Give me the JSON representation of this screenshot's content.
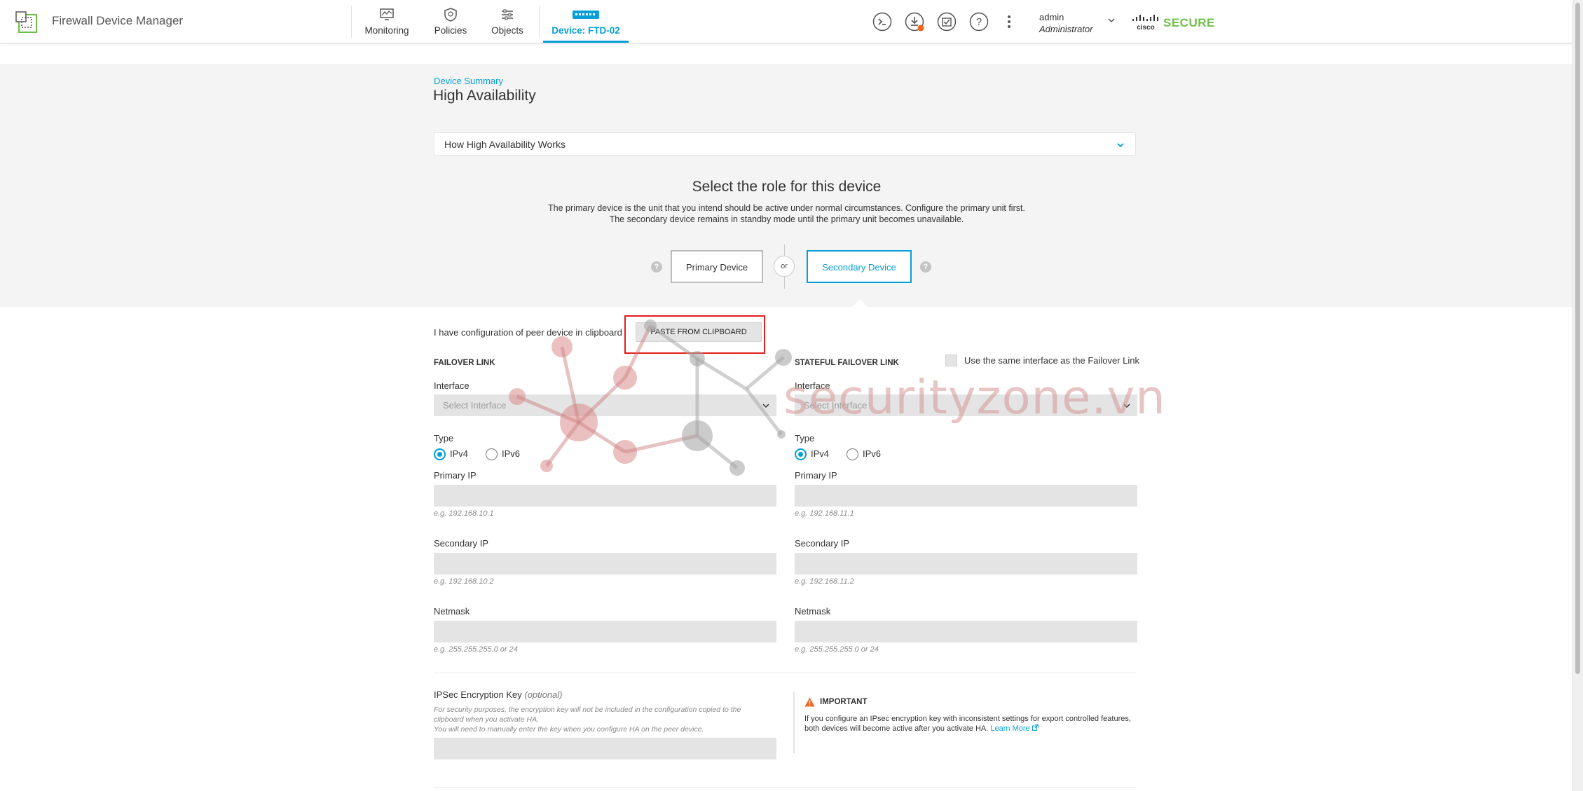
{
  "app": {
    "title": "Firewall Device Manager"
  },
  "nav": {
    "items": [
      {
        "label": "Monitoring",
        "icon": "monitoring-icon"
      },
      {
        "label": "Policies",
        "icon": "policies-icon"
      },
      {
        "label": "Objects",
        "icon": "objects-icon"
      },
      {
        "label": "Device: FTD-02",
        "icon": "device-icon",
        "active": true
      }
    ]
  },
  "toolbar_icons": [
    "cli-console-icon",
    "deploy-icon",
    "tasks-icon",
    "help-icon",
    "more-options-icon"
  ],
  "user": {
    "name": "admin",
    "role": "Administrator"
  },
  "brand": {
    "vendor": "cisco",
    "product": "SECURE",
    "accent": "#6cc04a"
  },
  "breadcrumb": {
    "parent": "Device Summary"
  },
  "page": {
    "title": "High Availability"
  },
  "accordion": {
    "label": "How High Availability Works"
  },
  "role": {
    "title": "Select the role for this device",
    "desc_line1": "The primary device is the unit that you intend should be active under normal circumstances. Configure the primary unit first.",
    "desc_line2": "The secondary device remains in standby mode until the primary unit becomes unavailable.",
    "primary_label": "Primary Device",
    "secondary_label": "Secondary Device",
    "or_label": "or",
    "selected": "Secondary Device"
  },
  "clipboard": {
    "text": "I have configuration of peer device in clipboard",
    "button": "PASTE FROM CLIPBOARD"
  },
  "failover": {
    "heading": "FAILOVER LINK",
    "interface_label": "Interface",
    "interface_placeholder": "Select Interface",
    "type_label": "Type",
    "ipv4": "IPv4",
    "ipv6": "IPv6",
    "selected_type": "IPv4",
    "primary_ip_label": "Primary IP",
    "primary_ip_hint": "e.g. 192.168.10.1",
    "secondary_ip_label": "Secondary IP",
    "secondary_ip_hint": "e.g. 192.168.10.2",
    "netmask_label": "Netmask",
    "netmask_hint": "e.g. 255.255.255.0 or 24"
  },
  "stateful": {
    "heading": "STATEFUL FAILOVER LINK",
    "same_interface_label": "Use the same interface as the Failover Link",
    "same_interface_checked": false,
    "interface_label": "Interface",
    "interface_placeholder": "Select Interface",
    "type_label": "Type",
    "ipv4": "IPv4",
    "ipv6": "IPv6",
    "selected_type": "IPv4",
    "primary_ip_label": "Primary IP",
    "primary_ip_hint": "e.g. 192.168.11.1",
    "secondary_ip_label": "Secondary IP",
    "secondary_ip_hint": "e.g. 192.168.11.2",
    "netmask_label": "Netmask",
    "netmask_hint": "e.g. 255.255.255.0 or 24"
  },
  "ipsec": {
    "label": "IPSec Encryption Key",
    "optional": "(optional)",
    "desc_line1": "For security purposes, the encryption key will not be included in the configuration copied to the",
    "desc_line2": "clipboard when you activate HA.",
    "desc_line3": "You will need to manually enter the key when you configure HA on the peer device."
  },
  "important": {
    "title": "IMPORTANT",
    "text": "If you configure an IPsec encryption key with inconsistent settings for export controlled features, both devices will become active after you activate HA.",
    "link": "Learn More"
  },
  "watermark": {
    "text": "securityzone.vn"
  },
  "colors": {
    "accent": "#049fd9",
    "highlight": "#e41d1d",
    "brand_green": "#6cc04a"
  }
}
